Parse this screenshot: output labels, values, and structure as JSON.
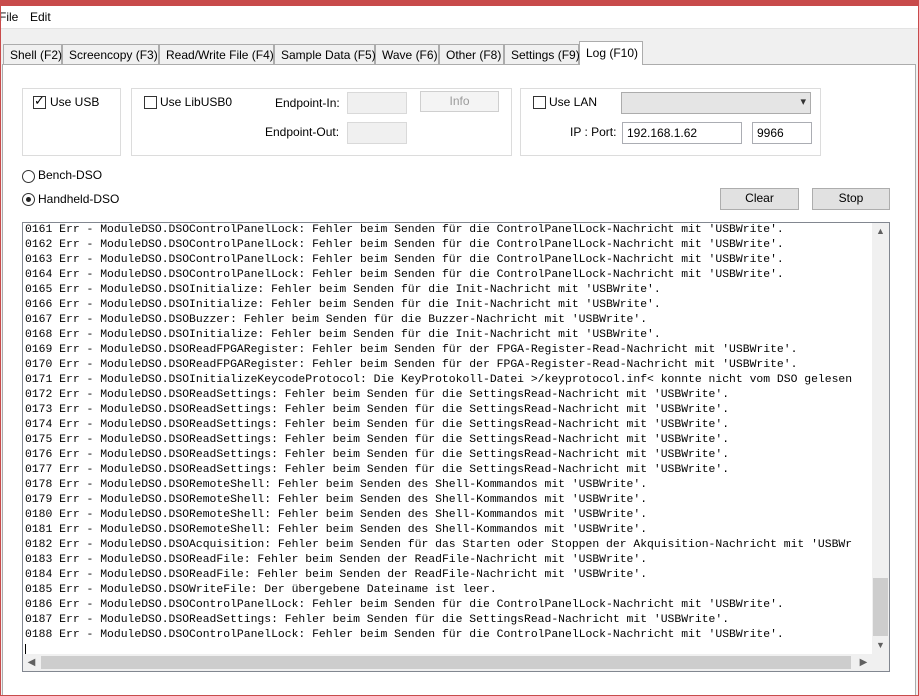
{
  "menu": {
    "file": "File",
    "edit": "Edit"
  },
  "tabs": [
    {
      "label": "Shell (F2)"
    },
    {
      "label": "Screencopy (F3)"
    },
    {
      "label": "Read/Write File (F4)"
    },
    {
      "label": "Sample Data (F5)"
    },
    {
      "label": "Wave (F6)"
    },
    {
      "label": "Other (F8)"
    },
    {
      "label": "Settings (F9)"
    },
    {
      "label": "Log (F10)"
    }
  ],
  "active_tab": "Log (F10)",
  "usb": {
    "label": "Use USB",
    "checked": true
  },
  "libusb": {
    "label": "Use LibUSB0",
    "checked": false,
    "endpoint_in_label": "Endpoint-In:",
    "endpoint_in_value": "",
    "endpoint_out_label": "Endpoint-Out:",
    "endpoint_out_value": "",
    "info_button": "Info"
  },
  "lan": {
    "label": "Use LAN",
    "checked": false,
    "combo_value": "",
    "ip_port_label": "IP : Port:",
    "ip": "192.168.1.62",
    "port": "9966"
  },
  "mode": {
    "bench": "Bench-DSO",
    "handheld": "Handheld-DSO",
    "selected": "Handheld-DSO"
  },
  "buttons": {
    "clear": "Clear",
    "stop": "Stop"
  },
  "log": [
    "0161 Err - ModuleDSO.DSOControlPanelLock: Fehler beim Senden für die ControlPanelLock-Nachricht mit 'USBWrite'.",
    "0162 Err - ModuleDSO.DSOControlPanelLock: Fehler beim Senden für die ControlPanelLock-Nachricht mit 'USBWrite'.",
    "0163 Err - ModuleDSO.DSOControlPanelLock: Fehler beim Senden für die ControlPanelLock-Nachricht mit 'USBWrite'.",
    "0164 Err - ModuleDSO.DSOControlPanelLock: Fehler beim Senden für die ControlPanelLock-Nachricht mit 'USBWrite'.",
    "0165 Err - ModuleDSO.DSOInitialize: Fehler beim Senden für die Init-Nachricht mit 'USBWrite'.",
    "0166 Err - ModuleDSO.DSOInitialize: Fehler beim Senden für die Init-Nachricht mit 'USBWrite'.",
    "0167 Err - ModuleDSO.DSOBuzzer: Fehler beim Senden für die Buzzer-Nachricht mit 'USBWrite'.",
    "0168 Err - ModuleDSO.DSOInitialize: Fehler beim Senden für die Init-Nachricht mit 'USBWrite'.",
    "0169 Err - ModuleDSO.DSOReadFPGARegister: Fehler beim Senden für der FPGA-Register-Read-Nachricht mit 'USBWrite'.",
    "0170 Err - ModuleDSO.DSOReadFPGARegister: Fehler beim Senden für der FPGA-Register-Read-Nachricht mit 'USBWrite'.",
    "0171 Err - ModuleDSO.DSOInitializeKeycodeProtocol: Die KeyProtokoll-Datei >/keyprotocol.inf< konnte nicht vom DSO gelesen",
    "0172 Err - ModuleDSO.DSOReadSettings: Fehler beim Senden für die SettingsRead-Nachricht mit 'USBWrite'.",
    "0173 Err - ModuleDSO.DSOReadSettings: Fehler beim Senden für die SettingsRead-Nachricht mit 'USBWrite'.",
    "0174 Err - ModuleDSO.DSOReadSettings: Fehler beim Senden für die SettingsRead-Nachricht mit 'USBWrite'.",
    "0175 Err - ModuleDSO.DSOReadSettings: Fehler beim Senden für die SettingsRead-Nachricht mit 'USBWrite'.",
    "0176 Err - ModuleDSO.DSOReadSettings: Fehler beim Senden für die SettingsRead-Nachricht mit 'USBWrite'.",
    "0177 Err - ModuleDSO.DSOReadSettings: Fehler beim Senden für die SettingsRead-Nachricht mit 'USBWrite'.",
    "0178 Err - ModuleDSO.DSORemoteShell: Fehler beim Senden des Shell-Kommandos mit 'USBWrite'.",
    "0179 Err - ModuleDSO.DSORemoteShell: Fehler beim Senden des Shell-Kommandos mit 'USBWrite'.",
    "0180 Err - ModuleDSO.DSORemoteShell: Fehler beim Senden des Shell-Kommandos mit 'USBWrite'.",
    "0181 Err - ModuleDSO.DSORemoteShell: Fehler beim Senden des Shell-Kommandos mit 'USBWrite'.",
    "0182 Err - ModuleDSO.DSOAcquisition: Fehler beim Senden für das Starten oder Stoppen der Akquisition-Nachricht mit 'USBWr",
    "0183 Err - ModuleDSO.DSOReadFile: Fehler beim Senden der ReadFile-Nachricht mit 'USBWrite'.",
    "0184 Err - ModuleDSO.DSOReadFile: Fehler beim Senden der ReadFile-Nachricht mit 'USBWrite'.",
    "0185 Err - ModuleDSO.DSOWriteFile: Der übergebene Dateiname ist leer.",
    "0186 Err - ModuleDSO.DSOControlPanelLock: Fehler beim Senden für die ControlPanelLock-Nachricht mit 'USBWrite'.",
    "0187 Err - ModuleDSO.DSOReadSettings: Fehler beim Senden für die SettingsRead-Nachricht mit 'USBWrite'.",
    "0188 Err - ModuleDSO.DSOControlPanelLock: Fehler beim Senden für die ControlPanelLock-Nachricht mit 'USBWrite'."
  ],
  "icons": {
    "check": "checkmark-icon",
    "combo_arrow": "chevron-down-icon",
    "scroll_up": "arrow-up-icon",
    "scroll_down": "arrow-down-icon",
    "scroll_left": "arrow-left-icon",
    "scroll_right": "arrow-right-icon"
  },
  "colors": {
    "window_frame": "#c84b4b",
    "button_face": "#e1e1e1",
    "scrollbar_thumb": "#cdcdcd"
  }
}
